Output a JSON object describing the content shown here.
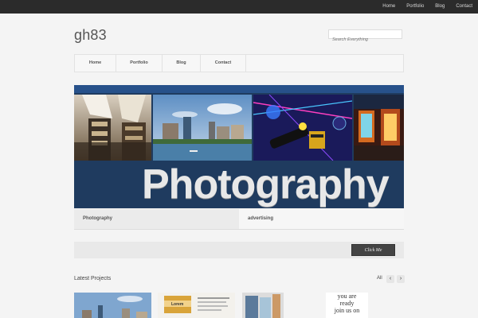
{
  "top_nav": [
    "Home",
    "Portfolio",
    "Blog",
    "Contact"
  ],
  "logo": "gh83",
  "search": {
    "placeholder": "Search Everything"
  },
  "main_nav": [
    "Home",
    "Portfolio",
    "Blog",
    "Contact"
  ],
  "hero": {
    "title": "Photography"
  },
  "tabs": [
    "Photography",
    "advertising"
  ],
  "cta": {
    "button_label": "Click Me"
  },
  "latest": {
    "heading": "Latest Projects",
    "filter_label": "All",
    "prev_label": "‹",
    "next_label": "›",
    "thumb_card_title": "Lorem",
    "thumb_text_lines": [
      "you are",
      "ready",
      "join us on"
    ]
  },
  "colors": {
    "topbar": "#2b2b2b",
    "hero_blue": "#1f3b5f",
    "accent_blue": "#27518a"
  }
}
